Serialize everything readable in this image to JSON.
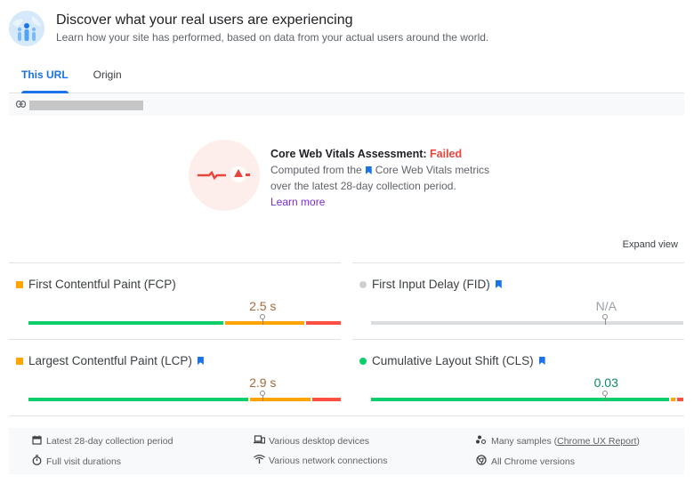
{
  "header": {
    "icon": "users-globe-icon",
    "title": "Discover what your real users are experiencing",
    "subtitle": "Learn how your site has performed, based on data from your actual users around the world."
  },
  "tabs": [
    {
      "label": "This URL",
      "active": true
    },
    {
      "label": "Origin",
      "active": false
    }
  ],
  "url_bar": {
    "icon": "link-icon",
    "url": "[redacted]"
  },
  "assessment": {
    "title": "Core Web Vitals Assessment: ",
    "status": "Failed",
    "status_color": "#e8453c",
    "line1_pre": "Computed from the",
    "line1_post": "Core Web Vitals metrics",
    "line2": "over the latest 28-day collection period.",
    "learn_more": "Learn more"
  },
  "expand_view": "Expand view",
  "metrics": [
    {
      "name": "First Contentful Paint (FCP)",
      "core": false,
      "indicator": "square",
      "indicator_color": "#ffa400",
      "value": "2.5 s",
      "value_color": "#a86a3d",
      "distribution": {
        "good": 0.63,
        "needs_improvement": 0.26,
        "poor": 0.11
      },
      "marker_percentile": 0.75
    },
    {
      "name": "First Input Delay (FID)",
      "core": true,
      "indicator": "circle",
      "indicator_color": "#d0d0d0",
      "value": "N/A",
      "value_color": "#9aa0a6",
      "distribution": {
        "no_data": 1.0
      },
      "marker_percentile": 0.75
    },
    {
      "name": "Largest Contentful Paint (LCP)",
      "core": true,
      "indicator": "square",
      "indicator_color": "#ffa400",
      "value": "2.9 s",
      "value_color": "#a86a3d",
      "distribution": {
        "good": 0.71,
        "needs_improvement": 0.2,
        "poor": 0.09
      },
      "marker_percentile": 0.75
    },
    {
      "name": "Cumulative Layout Shift (CLS)",
      "core": true,
      "indicator": "circle",
      "indicator_color": "#0cce6b",
      "value": "0.03",
      "value_color": "#0d8a6b",
      "distribution": {
        "good": 0.96,
        "needs_improvement": 0.02,
        "poor": 0.02
      },
      "marker_percentile": 0.75
    }
  ],
  "colors": {
    "good": "#0cce6b",
    "needs_improvement": "#ffa400",
    "poor": "#ff4e42",
    "no_data": "#dadce0"
  },
  "footer": [
    {
      "icon": "calendar-icon",
      "glyph": "▭",
      "text": "Latest 28-day collection period"
    },
    {
      "icon": "devices-icon",
      "glyph": "▭",
      "text": "Various desktop devices"
    },
    {
      "icon": "samples-icon",
      "glyph": "⁂",
      "text": "Many samples (",
      "link": "Chrome UX Report",
      "suffix": ")"
    },
    {
      "icon": "timer-icon",
      "glyph": "⏱",
      "text": "Full visit durations"
    },
    {
      "icon": "wifi-icon",
      "glyph": "≋",
      "text": "Various network connections"
    },
    {
      "icon": "chrome-icon",
      "glyph": "◎",
      "text": "All Chrome versions"
    }
  ]
}
